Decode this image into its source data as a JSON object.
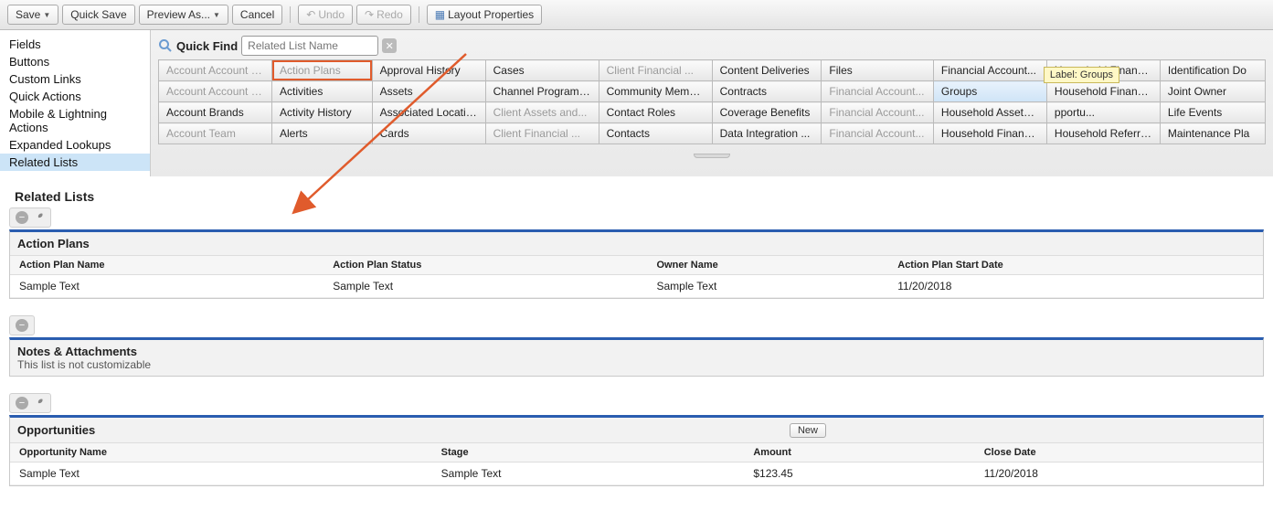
{
  "toolbar": {
    "save": "Save",
    "quick_save": "Quick Save",
    "preview_as": "Preview As...",
    "cancel": "Cancel",
    "undo": "Undo",
    "redo": "Redo",
    "layout_props": "Layout Properties"
  },
  "sidebar": {
    "items": [
      "Fields",
      "Buttons",
      "Custom Links",
      "Quick Actions",
      "Mobile & Lightning Actions",
      "Expanded Lookups",
      "Related Lists"
    ],
    "selected_index": 6
  },
  "quickfind": {
    "label": "Quick Find",
    "placeholder": "Related List Name"
  },
  "palette_grid": [
    [
      {
        "t": "Account Account R...",
        "g": true
      },
      {
        "t": "Action Plans",
        "g": true,
        "hl": true
      },
      {
        "t": "Approval History"
      },
      {
        "t": "Cases"
      },
      {
        "t": "Client Financial ...",
        "g": true
      },
      {
        "t": "Content Deliveries"
      },
      {
        "t": "Files"
      },
      {
        "t": "Financial Account..."
      },
      {
        "t": "Household Financi..."
      },
      {
        "t": "Identification Do"
      }
    ],
    [
      {
        "t": "Account Account R...",
        "g": true
      },
      {
        "t": "Activities"
      },
      {
        "t": "Assets"
      },
      {
        "t": "Channel Program M..."
      },
      {
        "t": "Community Members"
      },
      {
        "t": "Contracts"
      },
      {
        "t": "Financial Account...",
        "g": true
      },
      {
        "t": "Groups",
        "sel": true
      },
      {
        "t": "Household Financi..."
      },
      {
        "t": "Joint Owner"
      }
    ],
    [
      {
        "t": "Account Brands"
      },
      {
        "t": "Activity History"
      },
      {
        "t": "Associated Locations"
      },
      {
        "t": "Client Assets and...",
        "g": true
      },
      {
        "t": "Contact Roles"
      },
      {
        "t": "Coverage Benefits"
      },
      {
        "t": "Financial Account...",
        "g": true
      },
      {
        "t": "Household Assets ..."
      },
      {
        "t": "pportu..."
      },
      {
        "t": "Life Events"
      }
    ],
    [
      {
        "t": "Account Team",
        "g": true
      },
      {
        "t": "Alerts"
      },
      {
        "t": "Cards"
      },
      {
        "t": "Client Financial ...",
        "g": true
      },
      {
        "t": "Contacts"
      },
      {
        "t": "Data Integration ..."
      },
      {
        "t": "Financial Account...",
        "g": true
      },
      {
        "t": "Household Financi..."
      },
      {
        "t": "Household Referrals"
      },
      {
        "t": "Maintenance Pla"
      }
    ]
  ],
  "tooltip": {
    "label": "Label:",
    "value": "Groups"
  },
  "related_lists_title": "Related Lists",
  "action_plans": {
    "title": "Action Plans",
    "columns": [
      "Action Plan Name",
      "Action Plan Status",
      "Owner Name",
      "Action Plan Start Date"
    ],
    "row": [
      "Sample Text",
      "Sample Text",
      "Sample Text",
      "11/20/2018"
    ]
  },
  "notes": {
    "title": "Notes & Attachments",
    "sub": "This list is not customizable"
  },
  "opportunities": {
    "title": "Opportunities",
    "new_btn": "New",
    "columns": [
      "Opportunity Name",
      "Stage",
      "Amount",
      "Close Date"
    ],
    "row": [
      "Sample Text",
      "Sample Text",
      "$123.45",
      "11/20/2018"
    ]
  }
}
